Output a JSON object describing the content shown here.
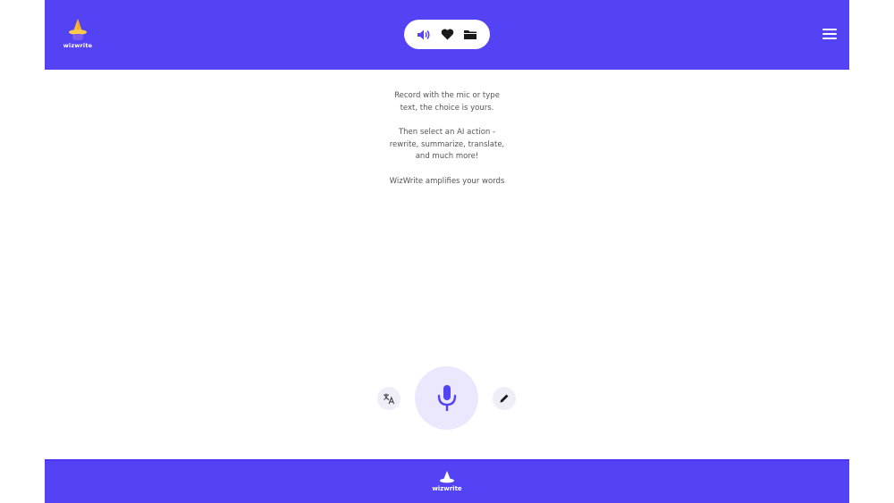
{
  "app": {
    "name": "wizwrite",
    "brand_color": "#5343f5",
    "accent_light": "#ebe8fd"
  },
  "header": {
    "logo_text": "wizwrite",
    "pill_buttons": [
      {
        "icon": "speaker-icon"
      },
      {
        "icon": "heart-icon"
      },
      {
        "icon": "folder-icon"
      }
    ],
    "menu_icon": "hamburger-menu-icon"
  },
  "intro": {
    "paragraph1_line1": "Record with the mic or type",
    "paragraph1_line2": "text, the choice is yours.",
    "paragraph2_line1": "Then select an AI action -",
    "paragraph2_line2": "rewrite, summarize, translate,",
    "paragraph2_line3": "and much more!",
    "paragraph3": "WizWrite amplifies your words"
  },
  "actions": {
    "left_icon": "translate-icon",
    "center_icon": "microphone-icon",
    "right_icon": "pencil-icon"
  },
  "footer": {
    "logo_text": "wizwrite"
  }
}
